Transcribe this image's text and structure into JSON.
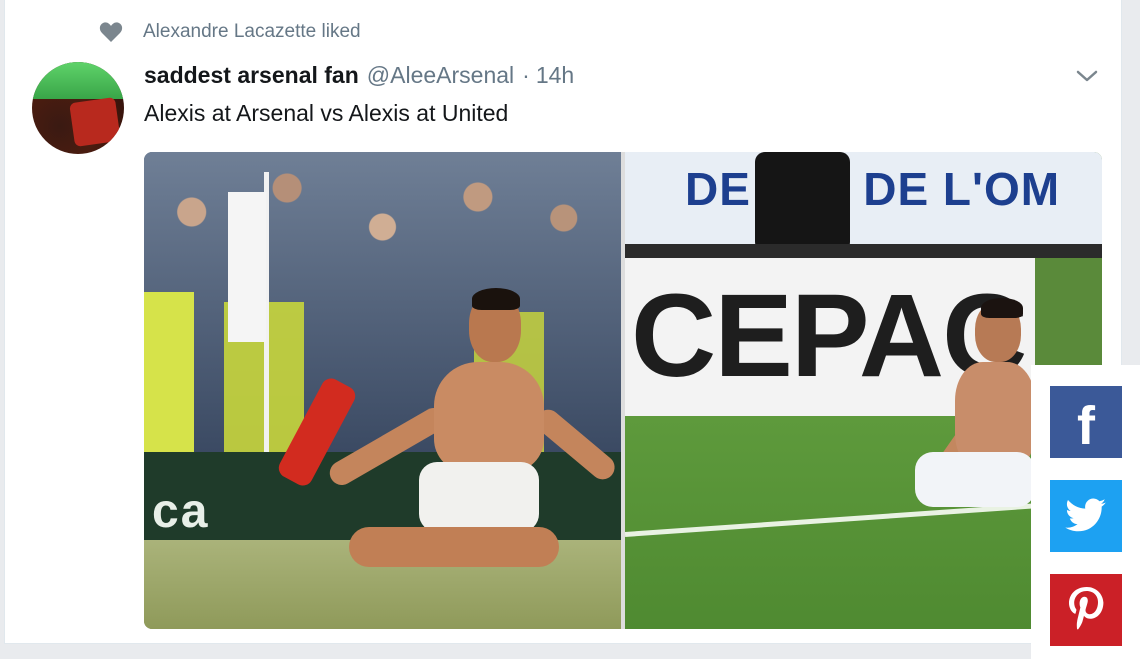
{
  "social_context": {
    "icon": "heart-icon",
    "text": "Alexandre Lacazette liked"
  },
  "tweet": {
    "display_name": "saddest arsenal fan",
    "handle": "@AleeArsenal",
    "separator": "·",
    "time": "14h",
    "text": "Alexis at Arsenal vs Alexis at United",
    "menu_icon": "chevron-down-icon"
  },
  "media": {
    "left_photo": {
      "adboard_text": "ca"
    },
    "right_photo": {
      "banner_text": "DE    MIS DE L'OM",
      "board_text": "CEPAC"
    }
  },
  "share": {
    "buttons": [
      {
        "icon": "facebook-icon",
        "color": "#3b5998"
      },
      {
        "icon": "twitter-icon",
        "color": "#1da1f2"
      },
      {
        "icon": "pinterest-icon",
        "color": "#cb2027"
      }
    ]
  }
}
